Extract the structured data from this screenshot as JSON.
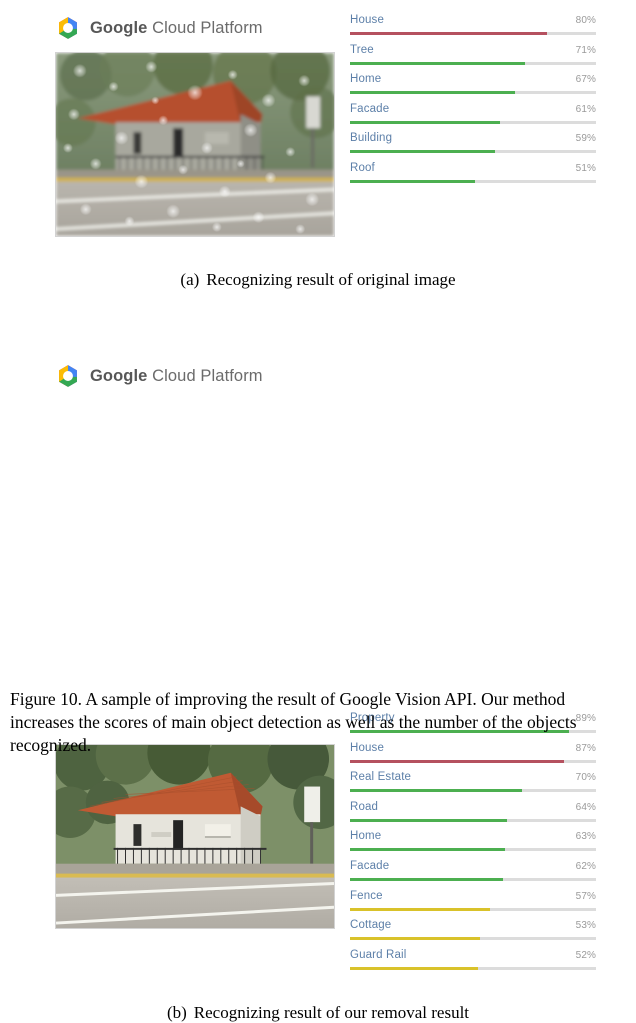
{
  "header": {
    "brand_google": "Google",
    "brand_cloud_platform": " Cloud Platform",
    "logo_icon": "gcp-hexagon-icon"
  },
  "colors": {
    "bar_green": "#4caf50",
    "bar_red": "#b5515f",
    "bar_yellow": "#d9c22a",
    "track": "#dcdcdc",
    "label_text": "#5c7fa8",
    "percent_text": "#9a9a9a",
    "wordmark": "#5c5c5c"
  },
  "panel_a": {
    "caption_tag": "(a)",
    "caption_text": "Recognizing result of original image",
    "photo_alt": "rain-speckled photo of a house behind a road",
    "results": [
      {
        "label": "House",
        "percent": "80%",
        "value": 80,
        "color": "#b5515f"
      },
      {
        "label": "Tree",
        "percent": "71%",
        "value": 71,
        "color": "#4caf50"
      },
      {
        "label": "Home",
        "percent": "67%",
        "value": 67,
        "color": "#4caf50"
      },
      {
        "label": "Facade",
        "percent": "61%",
        "value": 61,
        "color": "#4caf50"
      },
      {
        "label": "Building",
        "percent": "59%",
        "value": 59,
        "color": "#4caf50"
      },
      {
        "label": "Roof",
        "percent": "51%",
        "value": 51,
        "color": "#4caf50"
      }
    ]
  },
  "panel_b": {
    "caption_tag": "(b)",
    "caption_text": "Recognizing result of our removal result",
    "photo_alt": "clean photo of a house behind a road after raindrop removal",
    "results": [
      {
        "label": "Property",
        "percent": "89%",
        "value": 89,
        "color": "#4caf50"
      },
      {
        "label": "House",
        "percent": "87%",
        "value": 87,
        "color": "#b5515f"
      },
      {
        "label": "Real Estate",
        "percent": "70%",
        "value": 70,
        "color": "#4caf50"
      },
      {
        "label": "Road",
        "percent": "64%",
        "value": 64,
        "color": "#4caf50"
      },
      {
        "label": "Home",
        "percent": "63%",
        "value": 63,
        "color": "#4caf50"
      },
      {
        "label": "Facade",
        "percent": "62%",
        "value": 62,
        "color": "#4caf50"
      },
      {
        "label": "Fence",
        "percent": "57%",
        "value": 57,
        "color": "#d9c22a"
      },
      {
        "label": "Cottage",
        "percent": "53%",
        "value": 53,
        "color": "#d9c22a"
      },
      {
        "label": "Guard Rail",
        "percent": "52%",
        "value": 52,
        "color": "#d9c22a"
      }
    ]
  },
  "figure_caption": "Figure 10. A sample of improving the result of Google Vision API. Our method increases the scores of main object detection as well as the number of the objects recognized.",
  "chart_data": [
    {
      "type": "bar",
      "title": "(a) Recognizing result of original image",
      "orientation": "horizontal",
      "categories": [
        "House",
        "Tree",
        "Home",
        "Facade",
        "Building",
        "Roof"
      ],
      "values": [
        80,
        71,
        67,
        61,
        59,
        51
      ],
      "value_labels": [
        "80%",
        "71%",
        "67%",
        "61%",
        "59%",
        "51%"
      ],
      "bar_colors": [
        "#b5515f",
        "#4caf50",
        "#4caf50",
        "#4caf50",
        "#4caf50",
        "#4caf50"
      ],
      "xlabel": "",
      "ylabel": "",
      "xlim": [
        0,
        100
      ],
      "grid": false,
      "legend": false
    },
    {
      "type": "bar",
      "title": "(b) Recognizing result of our removal result",
      "orientation": "horizontal",
      "categories": [
        "Property",
        "House",
        "Real Estate",
        "Road",
        "Home",
        "Facade",
        "Fence",
        "Cottage",
        "Guard Rail"
      ],
      "values": [
        89,
        87,
        70,
        64,
        63,
        62,
        57,
        53,
        52
      ],
      "value_labels": [
        "89%",
        "87%",
        "70%",
        "64%",
        "63%",
        "62%",
        "57%",
        "53%",
        "52%"
      ],
      "bar_colors": [
        "#4caf50",
        "#b5515f",
        "#4caf50",
        "#4caf50",
        "#4caf50",
        "#4caf50",
        "#d9c22a",
        "#d9c22a",
        "#d9c22a"
      ],
      "xlabel": "",
      "ylabel": "",
      "xlim": [
        0,
        100
      ],
      "grid": false,
      "legend": false
    }
  ]
}
